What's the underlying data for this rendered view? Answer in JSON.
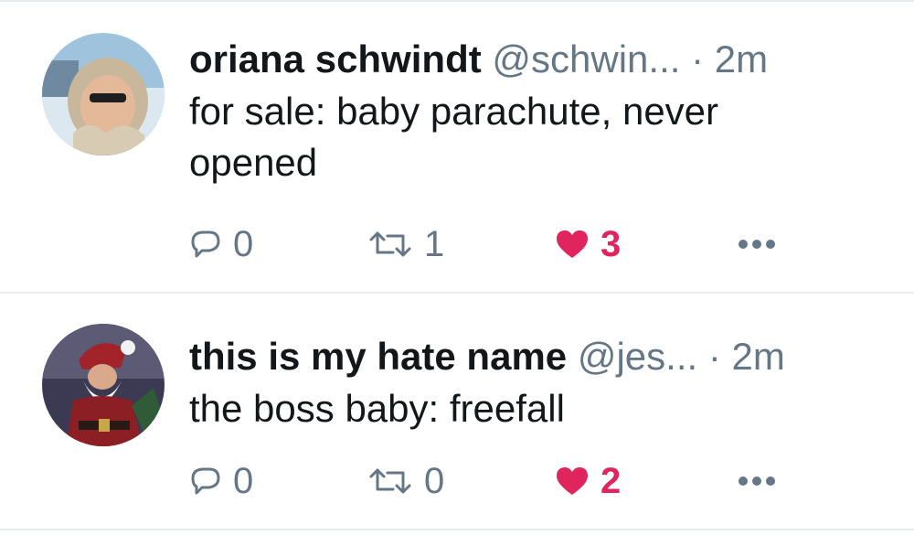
{
  "tweets": [
    {
      "name": "oriana schwindt",
      "handle": "@schwin...",
      "separator": "·",
      "time": "2m",
      "text": "for sale: baby parachute, never opened",
      "reply_count": "0",
      "retweet_count": "1",
      "like_count": "3",
      "liked": true,
      "avatar_icon": "woman-in-fur-hood-avatar"
    },
    {
      "name": "this is my hate name",
      "handle": "@jes...",
      "separator": "·",
      "time": "2m",
      "text": "the boss baby: freefall",
      "reply_count": "0",
      "retweet_count": "0",
      "like_count": "2",
      "liked": true,
      "avatar_icon": "santa-claus-avatar"
    }
  ],
  "colors": {
    "primary_text": "#14171a",
    "secondary_text": "#657786",
    "like": "#e0245e",
    "divider": "#e6ecf0"
  }
}
